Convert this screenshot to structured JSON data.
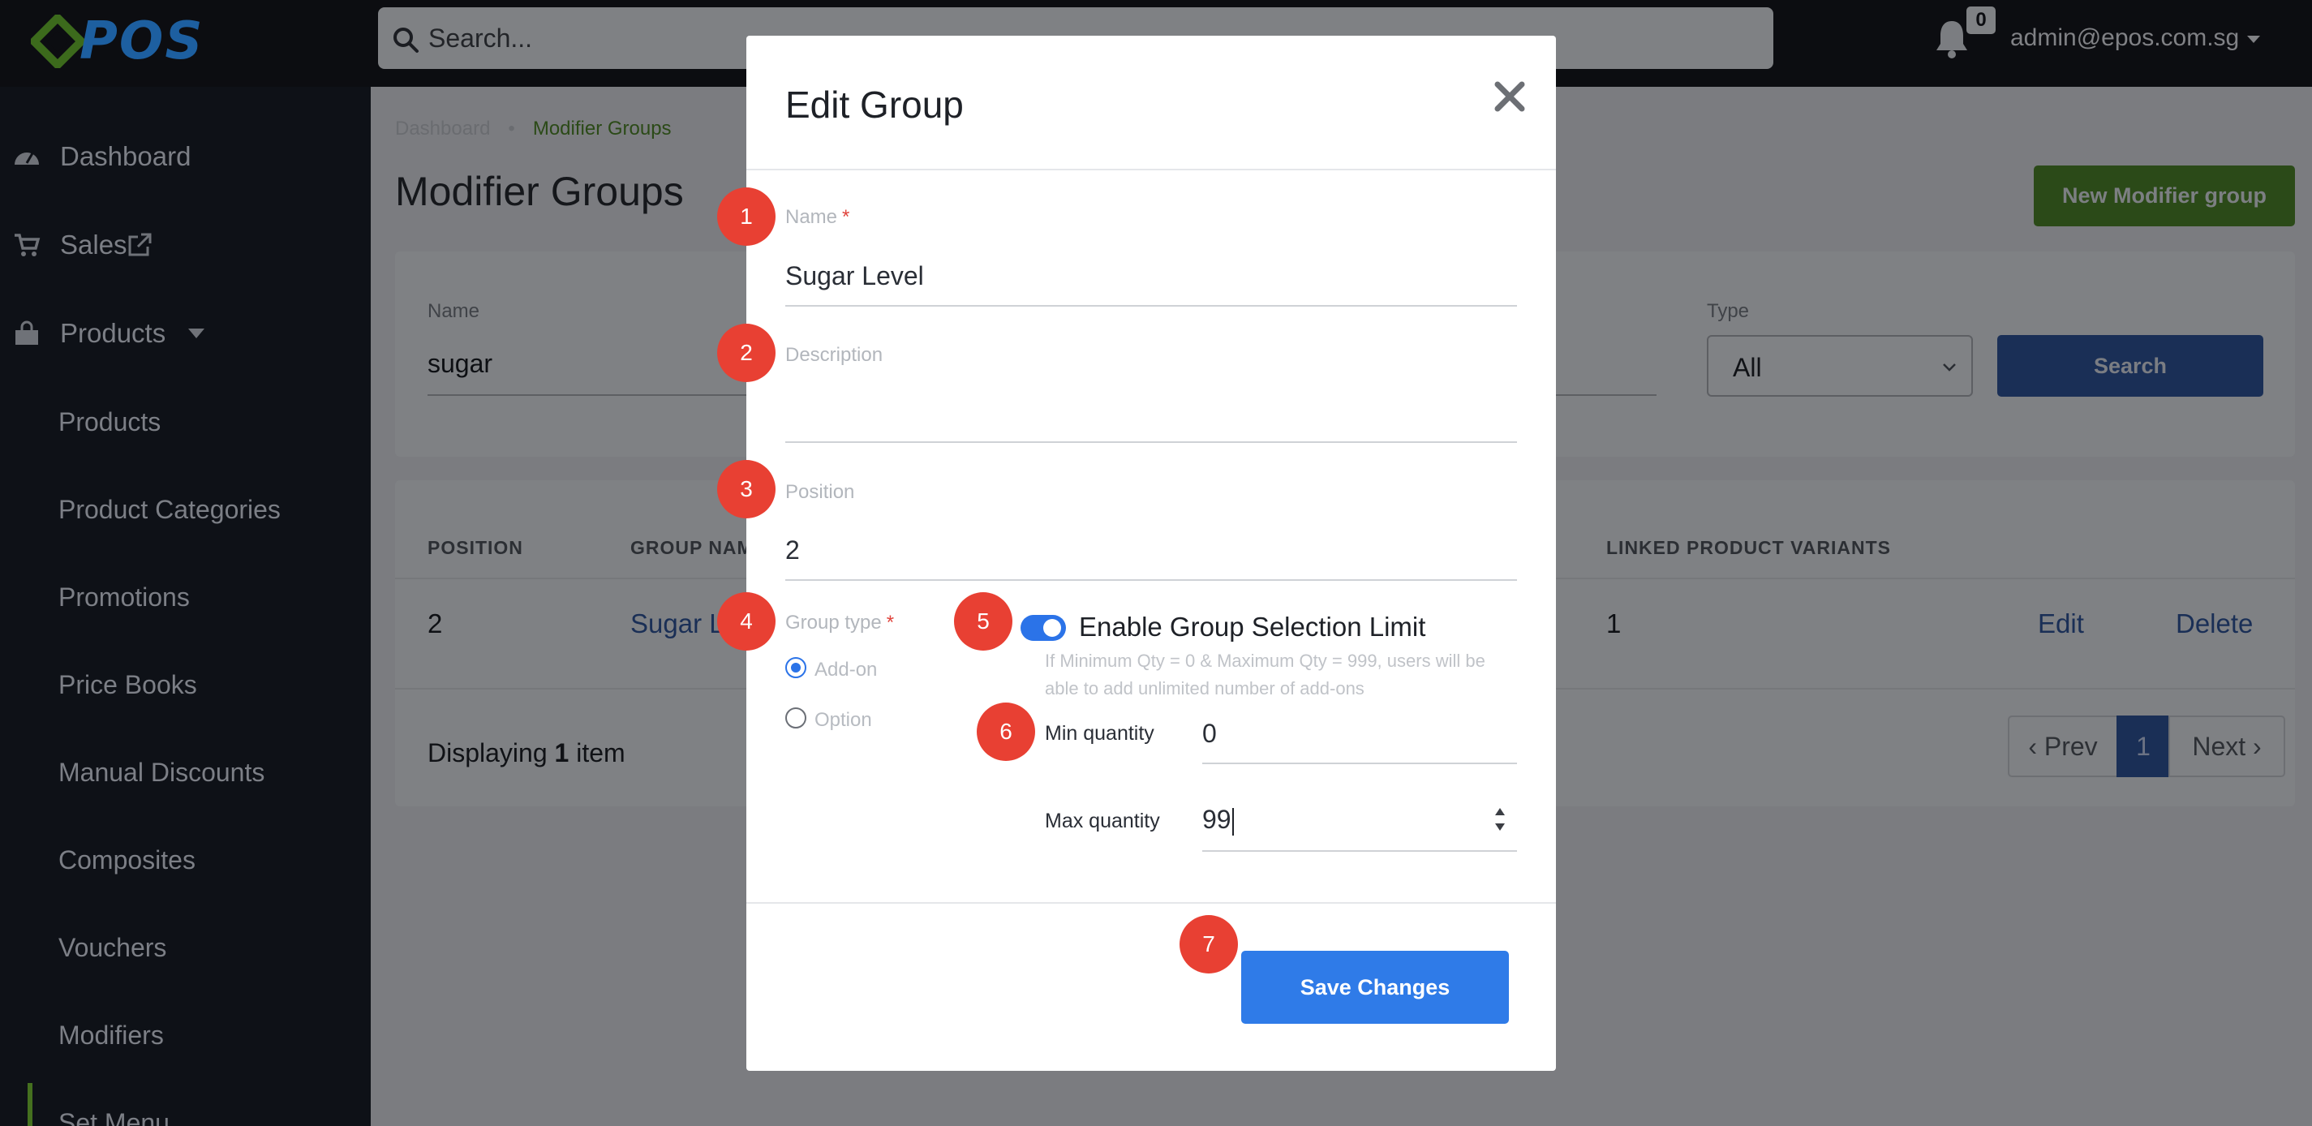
{
  "topbar": {
    "logo_text": "POS",
    "search_placeholder": "Search...",
    "notification_count": "0",
    "user_email": "admin@epos.com.sg"
  },
  "sidebar": {
    "items": [
      {
        "label": "Dashboard",
        "icon": "dashboard-icon"
      },
      {
        "label": "Sales",
        "icon": "cart-icon",
        "extra_icon": "external-link-icon"
      },
      {
        "label": "Products",
        "icon": "shopping-bag-icon",
        "extra_icon": "caret-down-icon"
      }
    ],
    "sub_items": [
      {
        "label": "Products"
      },
      {
        "label": "Product Categories"
      },
      {
        "label": "Promotions"
      },
      {
        "label": "Price Books"
      },
      {
        "label": "Manual Discounts"
      },
      {
        "label": "Composites"
      },
      {
        "label": "Vouchers"
      },
      {
        "label": "Modifiers",
        "active": true
      },
      {
        "label": "Set Menu"
      }
    ]
  },
  "main": {
    "breadcrumb": [
      "Dashboard",
      "Modifier Groups"
    ],
    "title": "Modifier Groups",
    "new_button": "New Modifier group",
    "filter": {
      "name_label": "Name",
      "name_value": "sugar",
      "type_label": "Type",
      "type_value": "All",
      "search_button": "Search"
    },
    "table": {
      "headers": [
        "POSITION",
        "GROUP NAME",
        "LINKED PRODUCT VARIANTS"
      ],
      "rows": [
        {
          "position": "2",
          "group_name": "Sugar Level",
          "linked_variants": "1",
          "edit": "Edit",
          "delete": "Delete"
        }
      ],
      "display_prefix": "Displaying ",
      "display_count": "1",
      "display_suffix": " item"
    },
    "pagination": {
      "prev": "‹ Prev",
      "current": "1",
      "next": "Next ›"
    }
  },
  "modal": {
    "title": "Edit Group",
    "name_label": "Name",
    "name_value": "Sugar Level",
    "description_label": "Description",
    "description_value": "",
    "position_label": "Position",
    "position_value": "2",
    "group_type_label": "Group type",
    "group_type_options": [
      {
        "label": "Add-on",
        "selected": true
      },
      {
        "label": "Option",
        "selected": false
      }
    ],
    "selection_limit_label": "Enable Group Selection Limit",
    "selection_limit_enabled": true,
    "selection_limit_hint": "If Minimum Qty = 0 & Maximum Qty = 999, users will be able to add unlimited number of add-ons",
    "min_qty_label": "Min quantity",
    "min_qty_value": "0",
    "max_qty_label": "Max quantity",
    "max_qty_value": "99",
    "save_button": "Save Changes"
  },
  "steps": [
    "1",
    "2",
    "3",
    "4",
    "5",
    "6",
    "7"
  ],
  "colors": {
    "accent_blue": "#2f7be8",
    "step_red": "#e84033",
    "required_red": "#e0443c",
    "brand_green": "#45701f",
    "brand_blue": "#1d5fa0"
  }
}
